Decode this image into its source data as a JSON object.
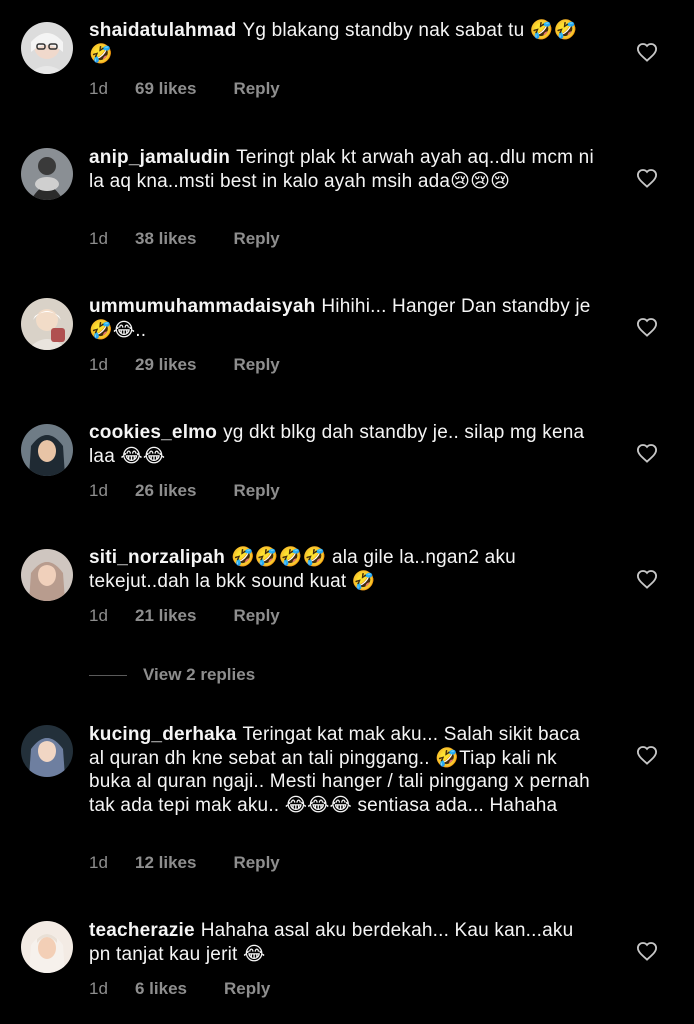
{
  "comments": [
    {
      "username": "shaidatulahmad",
      "text": "Yg blakang standby nak sabat tu 🤣🤣🤣",
      "time": "1d",
      "likes": "69 likes",
      "reply": "Reply"
    },
    {
      "username": "anip_jamaludin",
      "text": "Teringt plak kt arwah ayah aq..dlu mcm ni la aq kna..msti best in kalo ayah msih ada😢😢😢",
      "time": "1d",
      "likes": "38 likes",
      "reply": "Reply"
    },
    {
      "username": "ummumuhammadaisyah",
      "text": "Hihihi... Hanger Dan standby je🤣😂..",
      "time": "1d",
      "likes": "29 likes",
      "reply": "Reply"
    },
    {
      "username": "cookies_elmo",
      "text": "yg dkt blkg dah standby je.. silap mg kena laa 😂😂",
      "time": "1d",
      "likes": "26 likes",
      "reply": "Reply"
    },
    {
      "username": "siti_norzalipah",
      "text": "🤣🤣🤣🤣 ala gile la..ngan2 aku tekejut..dah la bkk sound kuat 🤣",
      "time": "1d",
      "likes": "21 likes",
      "reply": "Reply"
    },
    {
      "username": "kucing_derhaka",
      "text": "Teringat kat mak aku... Salah sikit baca al quran dh kne sebat an tali pinggang.. 🤣Tiap kali nk buka al quran ngaji.. Mesti hanger / tali pinggang x pernah tak ada tepi mak aku.. 😂😂😂 sentiasa ada... Hahaha",
      "time": "1d",
      "likes": "12 likes",
      "reply": "Reply"
    },
    {
      "username": "teacherazie",
      "text": "Hahaha asal aku berdekah... Kau kan...aku pn tanjat kau jerit 😂",
      "time": "1d",
      "likes": "6 likes",
      "reply": "Reply"
    }
  ],
  "view_replies": "View 2 replies",
  "colors": {
    "background": "#000000",
    "text": "#f5f5f5",
    "muted": "#8e8e8e"
  },
  "icons": {
    "like": "heart-outline-icon"
  }
}
